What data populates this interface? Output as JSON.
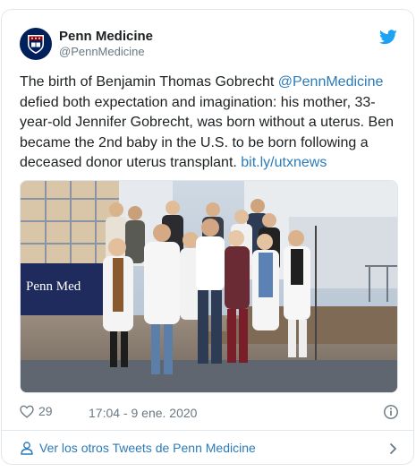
{
  "tweet": {
    "author": {
      "display_name": "Penn Medicine",
      "handle": "@PennMedicine",
      "avatar_icon": "penn-shield-icon"
    },
    "text_before": "The birth of Benjamin Thomas Gobrecht ",
    "mention": "@PennMedicine",
    "text_middle": " defied both expectation and imagination: his mother, 33-year-old Jennifer Gobrecht, was born without a uterus. Ben became the 2nd baby in the U.S. to be born following a deceased donor uterus transplant. ",
    "link": "bit.ly/utxnews",
    "photo": {
      "sign_text": "Penn Med",
      "alt": "Group photo of Penn Medicine staff"
    },
    "likes": "29",
    "timestamp": "17:04 - 9 ene. 2020"
  },
  "footer": {
    "label": "Ver los otros Tweets de Penn Medicine"
  },
  "colors": {
    "link": "#2b7bb9",
    "twitter_blue": "#1da1f2",
    "muted": "#697882",
    "penn_navy": "#011f5b"
  },
  "icons": [
    "twitter-bird-icon",
    "heart-icon",
    "info-icon",
    "user-icon",
    "chevron-right-icon"
  ]
}
